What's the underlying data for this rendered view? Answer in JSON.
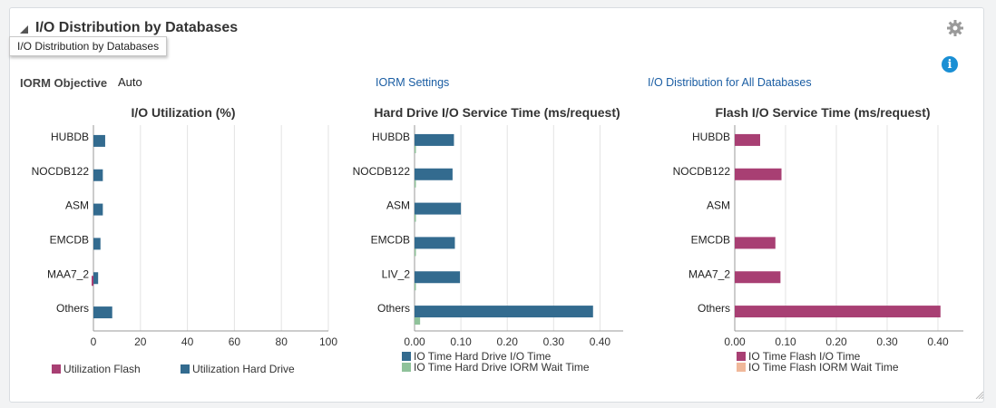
{
  "header": {
    "title": "I/O Distribution by Databases"
  },
  "tooltip": {
    "text": "I/O Distribution by Databases"
  },
  "icons": {
    "settings": "gear-icon",
    "info": "info-icon",
    "collapse": "collapse-triangle-icon"
  },
  "iorm": {
    "label": "IORM Objective",
    "value": "Auto"
  },
  "links": {
    "settings": "IORM Settings",
    "all_databases": "I/O Distribution for All Databases"
  },
  "info_glyph": "i",
  "chart_data": [
    {
      "type": "bar",
      "title": "I/O Utilization (%)",
      "orientation": "horizontal",
      "categories": [
        "HUBDB",
        "NOCDB122",
        "ASM",
        "EMCDB",
        "MAA7_2",
        "Others"
      ],
      "xlim": [
        0,
        100
      ],
      "ticks": [
        "0",
        "20",
        "40",
        "60",
        "80",
        "100"
      ],
      "grid": true,
      "legend": "bottom",
      "series": [
        {
          "name": "Utilization Flash",
          "color": "#a83f73",
          "values": [
            0,
            0,
            0,
            0,
            0.8,
            0
          ]
        },
        {
          "name": "Utilization Hard Drive",
          "color": "#336b8f",
          "values": [
            5,
            4,
            4,
            3,
            2,
            8
          ]
        }
      ]
    },
    {
      "type": "bar",
      "title": "Hard Drive I/O Service Time (ms/request)",
      "orientation": "horizontal",
      "categories": [
        "HUBDB",
        "NOCDB122",
        "ASM",
        "EMCDB",
        "LIV_2",
        "Others"
      ],
      "xlim": [
        0,
        0.45
      ],
      "ticks": [
        "0.00",
        "0.10",
        "0.20",
        "0.30",
        "0.40"
      ],
      "grid": true,
      "legend": "bottom",
      "series": [
        {
          "name": "IO Time Hard Drive I/O Time",
          "color": "#336b8f",
          "values": [
            0.085,
            0.082,
            0.1,
            0.087,
            0.098,
            0.385
          ]
        },
        {
          "name": "IO Time Hard Drive IORM Wait Time",
          "color": "#8fc29a",
          "values": [
            0.003,
            0.002,
            0.003,
            0.003,
            0.002,
            0.012
          ]
        }
      ]
    },
    {
      "type": "bar",
      "title": "Flash I/O Service Time (ms/request)",
      "orientation": "horizontal",
      "categories": [
        "HUBDB",
        "NOCDB122",
        "ASM",
        "EMCDB",
        "MAA7_2",
        "Others"
      ],
      "xlim": [
        0,
        0.45
      ],
      "ticks": [
        "0.00",
        "0.10",
        "0.20",
        "0.30",
        "0.40"
      ],
      "grid": true,
      "legend": "bottom",
      "series": [
        {
          "name": "IO Time Flash I/O Time",
          "color": "#a83f73",
          "values": [
            0.05,
            0.092,
            0,
            0.08,
            0.09,
            0.405
          ]
        },
        {
          "name": "IO Time Flash IORM Wait Time",
          "color": "#f0b89a",
          "values": [
            0,
            0,
            0,
            0,
            0,
            0
          ]
        }
      ]
    }
  ]
}
